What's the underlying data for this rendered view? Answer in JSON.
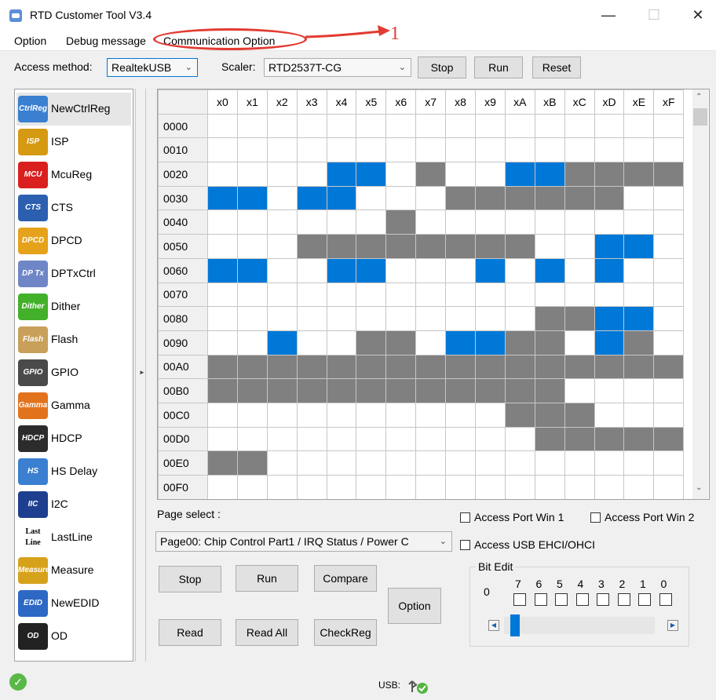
{
  "window": {
    "title": "RTD Customer Tool V3.4",
    "minimize_glyph": "—",
    "maximize_glyph": "☐",
    "close_glyph": "✕"
  },
  "menu": {
    "items": [
      "Option",
      "Debug message",
      "Communication Option"
    ]
  },
  "annotation": {
    "number": "1",
    "color": "#e23b32"
  },
  "toolbar": {
    "access_label": "Access method:",
    "access_value": "RealtekUSB",
    "scaler_label": "Scaler:",
    "scaler_value": "RTD2537T-CG",
    "stop": "Stop",
    "run": "Run",
    "reset": "Reset"
  },
  "sidebar": {
    "items": [
      {
        "label": "NewCtrlReg",
        "icon": "ctrlreg-icon",
        "icon_text": "CtrlReg",
        "color": "#3a7fd0",
        "selected": true
      },
      {
        "label": "ISP",
        "icon": "isp-icon",
        "icon_text": "ISP",
        "color": "#d59a12"
      },
      {
        "label": "McuReg",
        "icon": "mcu-icon",
        "icon_text": "MCU",
        "color": "#d9201e"
      },
      {
        "label": "CTS",
        "icon": "cts-icon",
        "icon_text": "CTS",
        "color": "#2d5fb0"
      },
      {
        "label": "DPCD",
        "icon": "dpcd-icon",
        "icon_text": "DPCD",
        "color": "#e6a21a"
      },
      {
        "label": "DPTxCtrl",
        "icon": "dptx-icon",
        "icon_text": "DP Tx",
        "color": "#6f86c6"
      },
      {
        "label": "Dither",
        "icon": "dither-icon",
        "icon_text": "Dither",
        "color": "#43b02a"
      },
      {
        "label": "Flash",
        "icon": "flash-icon",
        "icon_text": "Flash",
        "color": "#c8a05a"
      },
      {
        "label": "GPIO",
        "icon": "gpio-icon",
        "icon_text": "GPIO",
        "color": "#4a4a4a"
      },
      {
        "label": "Gamma",
        "icon": "gamma-icon",
        "icon_text": "Gamma",
        "color": "#e2731d"
      },
      {
        "label": "HDCP",
        "icon": "hdcp-icon",
        "icon_text": "HDCP",
        "color": "#2c2c2c"
      },
      {
        "label": "HS Delay",
        "icon": "hsdelay-icon",
        "icon_text": "HS Delay",
        "color": "#3a7fd0"
      },
      {
        "label": "I2C",
        "icon": "i2c-icon",
        "icon_text": "IIC",
        "color": "#1e3f8f"
      },
      {
        "label": "LastLine",
        "icon": "lastline-icon",
        "icon_text": "Last Line",
        "color": "#ffffff"
      },
      {
        "label": "Measure",
        "icon": "measure-icon",
        "icon_text": "Measure",
        "color": "#d7a21b"
      },
      {
        "label": "NewEDID",
        "icon": "edid-icon",
        "icon_text": "EDID",
        "color": "#2d68c4"
      },
      {
        "label": "OD",
        "icon": "od-icon",
        "icon_text": "OD",
        "color": "#222222"
      }
    ]
  },
  "grid": {
    "columns": [
      "x0",
      "x1",
      "x2",
      "x3",
      "x4",
      "x5",
      "x6",
      "x7",
      "x8",
      "x9",
      "xA",
      "xB",
      "xC",
      "xD",
      "xE",
      "xF"
    ],
    "rows": [
      {
        "addr": "0000",
        "cells": "wwwwwwwwwwwwwwww"
      },
      {
        "addr": "0010",
        "cells": "wwwwwwwwwwwwwwww"
      },
      {
        "addr": "0020",
        "cells": "wwwwbbwgwwbbggggw"
      },
      {
        "addr": "0030",
        "cells": "bbwbbwwwggggggwww"
      },
      {
        "addr": "0040",
        "cells": "wwwwwwgwwwwwwwwww"
      },
      {
        "addr": "0050",
        "cells": "wwwggggggggwwbbwww"
      },
      {
        "addr": "0060",
        "cells": "bbwwbbwwwbwbwbwww"
      },
      {
        "addr": "0070",
        "cells": "wwwwwwwwwwwwwwwww"
      },
      {
        "addr": "0080",
        "cells": "wwwwwwwwwwwggbbwww"
      },
      {
        "addr": "0090",
        "cells": "wwbwwggwbbggwbgwww"
      },
      {
        "addr": "00A0",
        "cells": "gggggggggggggggg"
      },
      {
        "addr": "00B0",
        "cells": "ggggggggggggwwwww"
      },
      {
        "addr": "00C0",
        "cells": "wwwwwwwwwwgggwwww"
      },
      {
        "addr": "00D0",
        "cells": "wwwwwwwwwwwgggggg"
      },
      {
        "addr": "00E0",
        "cells": "ggwwwwwwwwwwwwwww"
      },
      {
        "addr": "00F0",
        "cells": "wwwwwwwwwwwwwwwww"
      }
    ],
    "colors": {
      "blue": "#0078d7",
      "gray": "#808080",
      "white": "#ffffff"
    }
  },
  "page_select": {
    "label": "Page select :",
    "value": "Page00: Chip Control Part1 / IRQ Status / Power C"
  },
  "options": {
    "access_port_win1": "Access Port Win 1",
    "access_port_win2": "Access Port Win 2",
    "access_usb": "Access USB EHCI/OHCI"
  },
  "buttons": {
    "stop": "Stop",
    "run": "Run",
    "compare": "Compare",
    "option": "Option",
    "read": "Read",
    "read_all": "Read All",
    "check_reg": "CheckReg"
  },
  "bit_edit": {
    "title": "Bit Edit",
    "value": "0",
    "bits": [
      "7",
      "6",
      "5",
      "4",
      "3",
      "2",
      "1",
      "0"
    ]
  },
  "status": {
    "usb_label": "USB:"
  }
}
